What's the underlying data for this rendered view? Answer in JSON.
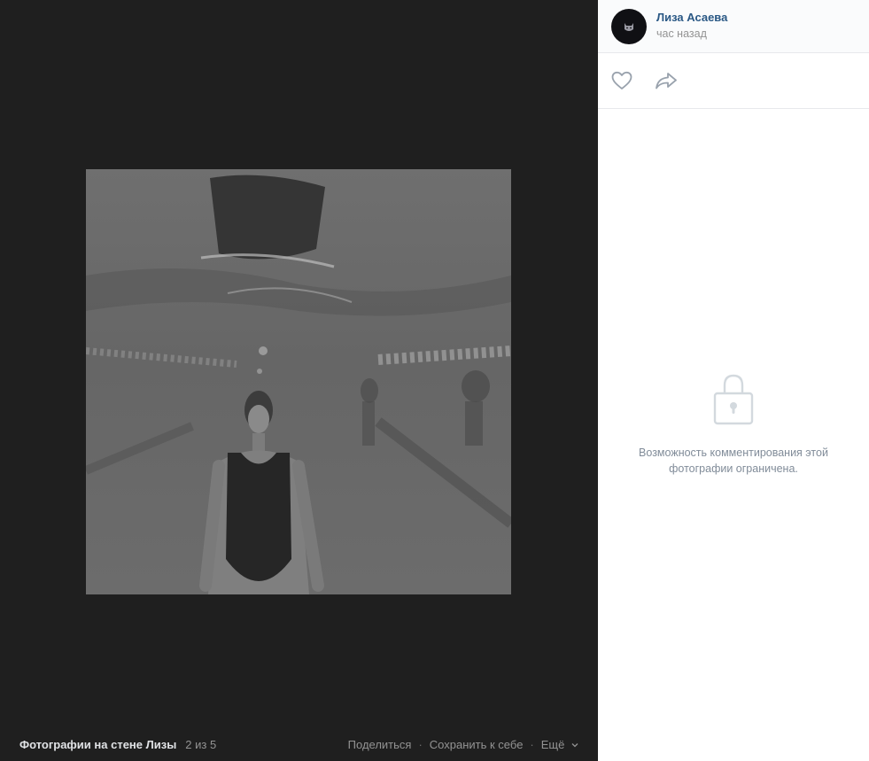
{
  "viewer": {
    "album_title": "Фотографии на стене Лизы",
    "counter": "2 из 5",
    "actions": {
      "share": "Поделиться",
      "save": "Сохранить к себе",
      "more": "Ещё"
    }
  },
  "post": {
    "author_name": "Лиза Асаева",
    "time": "час назад"
  },
  "comments": {
    "restricted_text": "Возможность комментирования этой фотографии ограничена."
  },
  "icons": {
    "like": "heart-icon",
    "share": "share-arrow-icon",
    "lock": "lock-icon",
    "more": "chevron-down-icon"
  },
  "colors": {
    "viewer_bg": "#1f1f1f",
    "link": "#2a5885",
    "muted": "#939393",
    "icon_blue": "#99a2ad"
  }
}
